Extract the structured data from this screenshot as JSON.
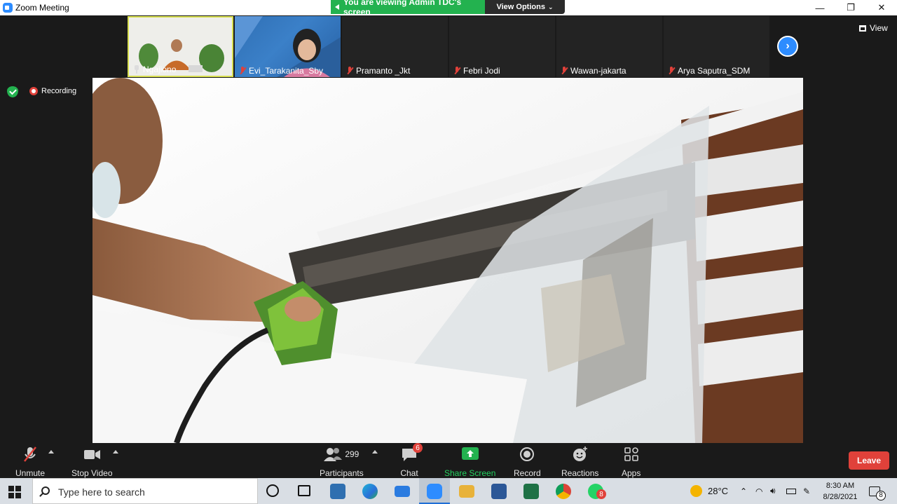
{
  "window": {
    "title": "Zoom Meeting"
  },
  "share_banner": {
    "text": "You are viewing Admin TDC's screen",
    "options_label": "View Options"
  },
  "gallery": {
    "tiles": [
      {
        "name": "Ngajiono",
        "muted": false,
        "pinned": true
      },
      {
        "name": "Evi_Tarakanita_Sby",
        "muted": true
      },
      {
        "name": "Pramanto _Jkt",
        "muted": true
      },
      {
        "name": "Febri Jodi",
        "muted": true
      },
      {
        "name": "Wawan-jakarta",
        "muted": true
      },
      {
        "name": "Arya Saputra_SDM",
        "muted": true
      }
    ],
    "view_label": "View"
  },
  "status": {
    "recording_label": "Recording"
  },
  "toolbar": {
    "unmute_label": "Unmute",
    "stop_video_label": "Stop Video",
    "participants_count": "299",
    "participants_label": "Participants",
    "chat_label": "Chat",
    "chat_badge": "6",
    "share_screen_label": "Share Screen",
    "record_label": "Record",
    "reactions_label": "Reactions",
    "apps_label": "Apps",
    "leave_label": "Leave"
  },
  "taskbar": {
    "search_placeholder": "Type here to search",
    "whatsapp_badge": "8",
    "temperature": "28°C",
    "time": "8:30 AM",
    "date": "8/28/2021",
    "notification_count": "8"
  },
  "colors": {
    "zoom_blue": "#2d8cff",
    "banner_green": "#23b24f",
    "leave_red": "#e0413a",
    "toolbar_bg": "#1a1a1a"
  }
}
